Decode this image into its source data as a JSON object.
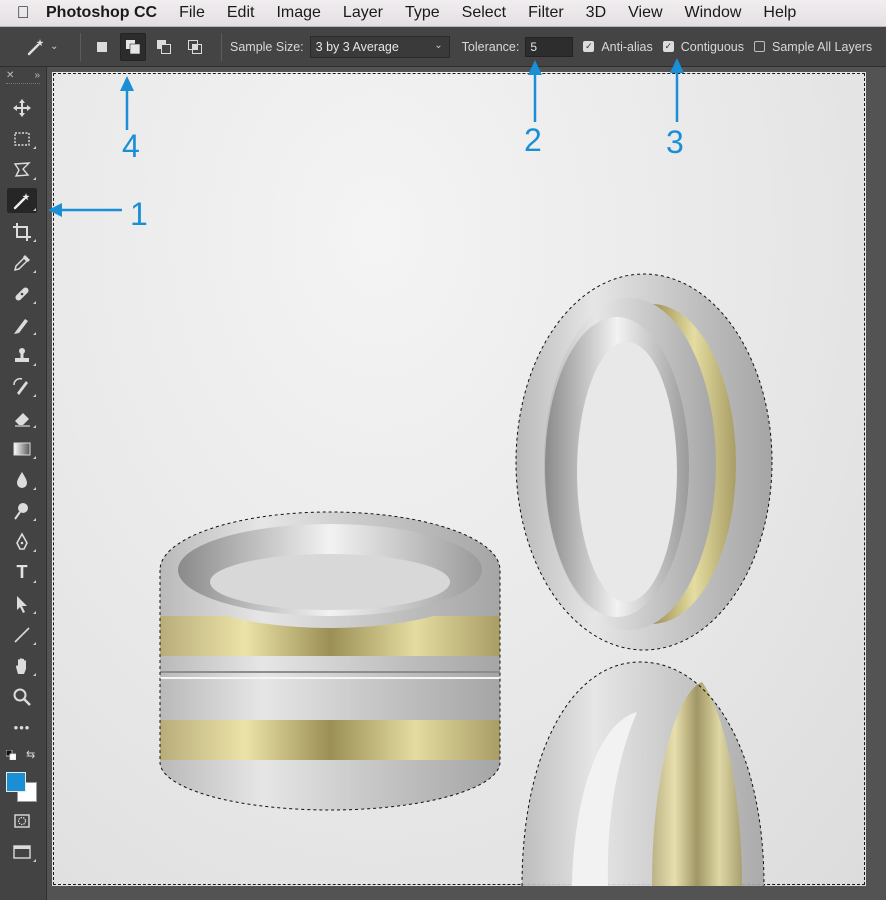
{
  "menubar": {
    "app_name": "Photoshop CC",
    "items": [
      "File",
      "Edit",
      "Image",
      "Layer",
      "Type",
      "Select",
      "Filter",
      "3D",
      "View",
      "Window",
      "Help"
    ]
  },
  "options_bar": {
    "sample_size_label": "Sample Size:",
    "sample_size_value": "3 by 3 Average",
    "tolerance_label": "Tolerance:",
    "tolerance_value": "5",
    "anti_alias_label": "Anti-alias",
    "anti_alias_checked": true,
    "contiguous_label": "Contiguous",
    "contiguous_checked": true,
    "sample_all_layers_label": "Sample All Layers",
    "sample_all_layers_checked": false,
    "selection_modes": [
      "new-selection",
      "add-to-selection",
      "subtract-from-selection",
      "intersect-with-selection"
    ],
    "active_selection_mode": "add-to-selection"
  },
  "toolbox": {
    "tools": [
      "move",
      "marquee",
      "lasso",
      "magic-wand",
      "crop",
      "eyedropper",
      "healing-brush",
      "brush",
      "clone-stamp",
      "history-brush",
      "eraser",
      "gradient",
      "blur",
      "dodge",
      "pen",
      "type",
      "path-selection",
      "line",
      "hand",
      "zoom",
      "more"
    ],
    "selected_tool": "magic-wand",
    "type_tool_glyph": "T",
    "more_glyph": "•••",
    "foreground_color": "#1b8fd6",
    "background_color": "#ffffff"
  },
  "annotations": {
    "color": "#1b8fd6",
    "labels": [
      "1",
      "2",
      "3",
      "4"
    ]
  }
}
